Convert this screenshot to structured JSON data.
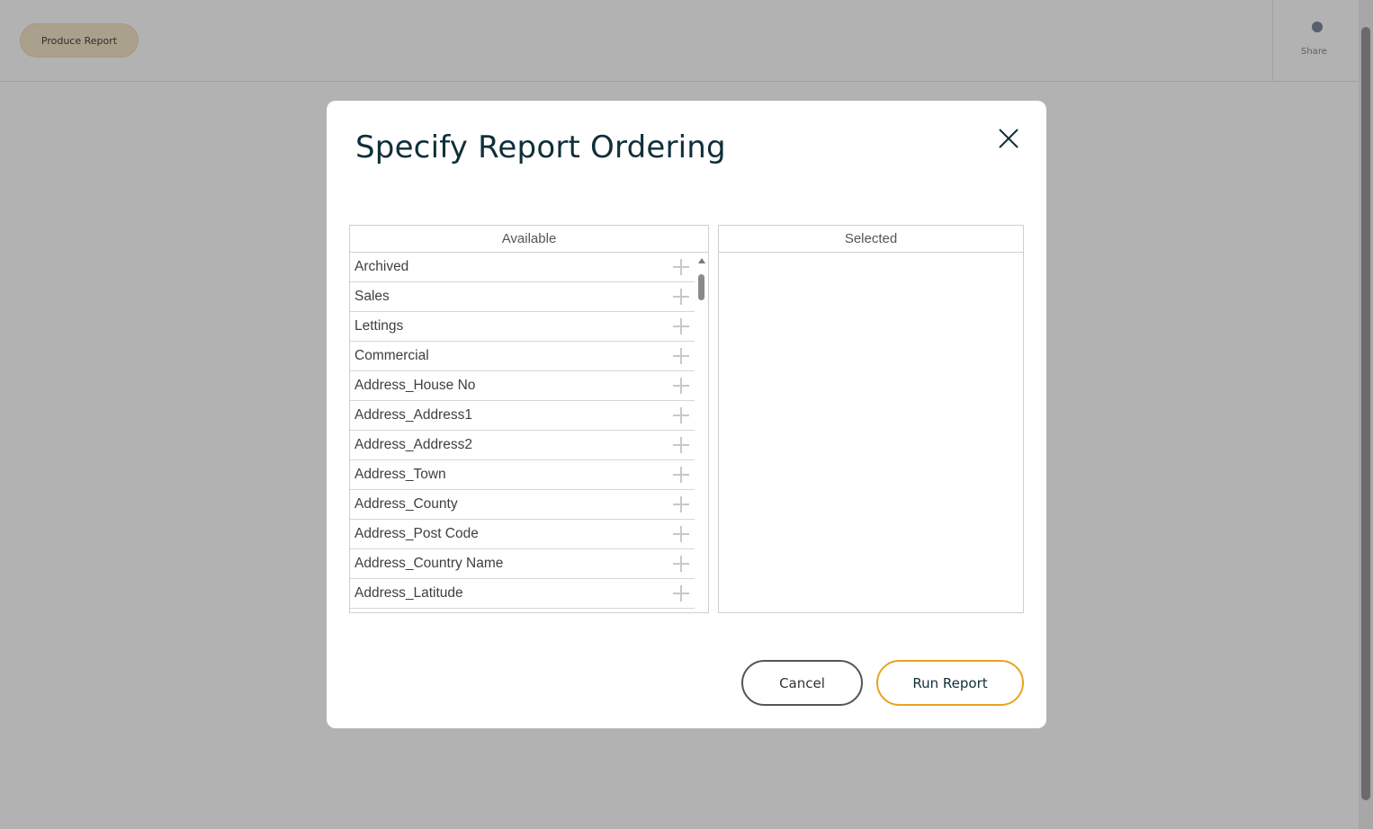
{
  "background": {
    "produce_button_label": "Produce Report",
    "share_label": "Share"
  },
  "modal": {
    "title": "Specify Report Ordering",
    "close_icon": "close-icon",
    "available": {
      "header": "Available",
      "items": [
        "Archived",
        "Sales",
        "Lettings",
        "Commercial",
        "Address_House No",
        "Address_Address1",
        "Address_Address2",
        "Address_Town",
        "Address_County",
        "Address_Post Code",
        "Address_Country Name",
        "Address_Latitude"
      ]
    },
    "selected": {
      "header": "Selected",
      "items": []
    },
    "buttons": {
      "cancel": "Cancel",
      "run": "Run Report"
    }
  },
  "colors": {
    "title": "#0f2f3a",
    "accent": "#e8a320",
    "overlay": "rgba(0,0,0,0.3)"
  }
}
